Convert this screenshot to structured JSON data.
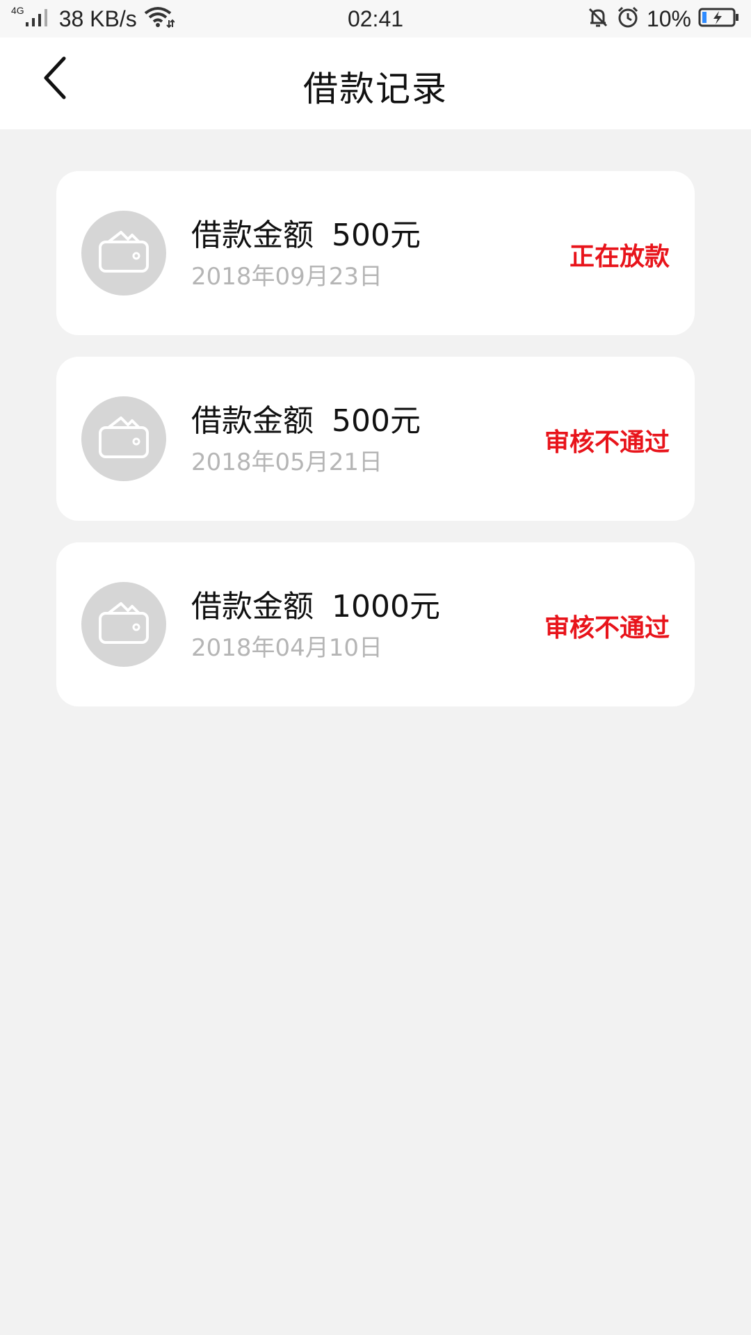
{
  "status_bar": {
    "network_type": "4G",
    "speed": "38 KB/s",
    "time": "02:41",
    "battery": "10%"
  },
  "header": {
    "title": "借款记录"
  },
  "records": [
    {
      "label": "借款金额",
      "amount": "500元",
      "date": "2018年09月23日",
      "status": "正在放款"
    },
    {
      "label": "借款金额",
      "amount": "500元",
      "date": "2018年05月21日",
      "status": "审核不通过"
    },
    {
      "label": "借款金额",
      "amount": "1000元",
      "date": "2018年04月10日",
      "status": "审核不通过"
    }
  ],
  "icons": {
    "back": "chevron-left-icon",
    "record": "wallet-icon",
    "signal": "signal-icon",
    "wifi": "wifi-icon",
    "mute": "bell-off-icon",
    "alarm": "alarm-icon",
    "battery": "battery-charging-icon"
  },
  "colors": {
    "status_red": "#e8141b",
    "date_gray": "#b5b5b5",
    "avatar_gray": "#d6d6d6",
    "background": "#f2f2f2"
  }
}
